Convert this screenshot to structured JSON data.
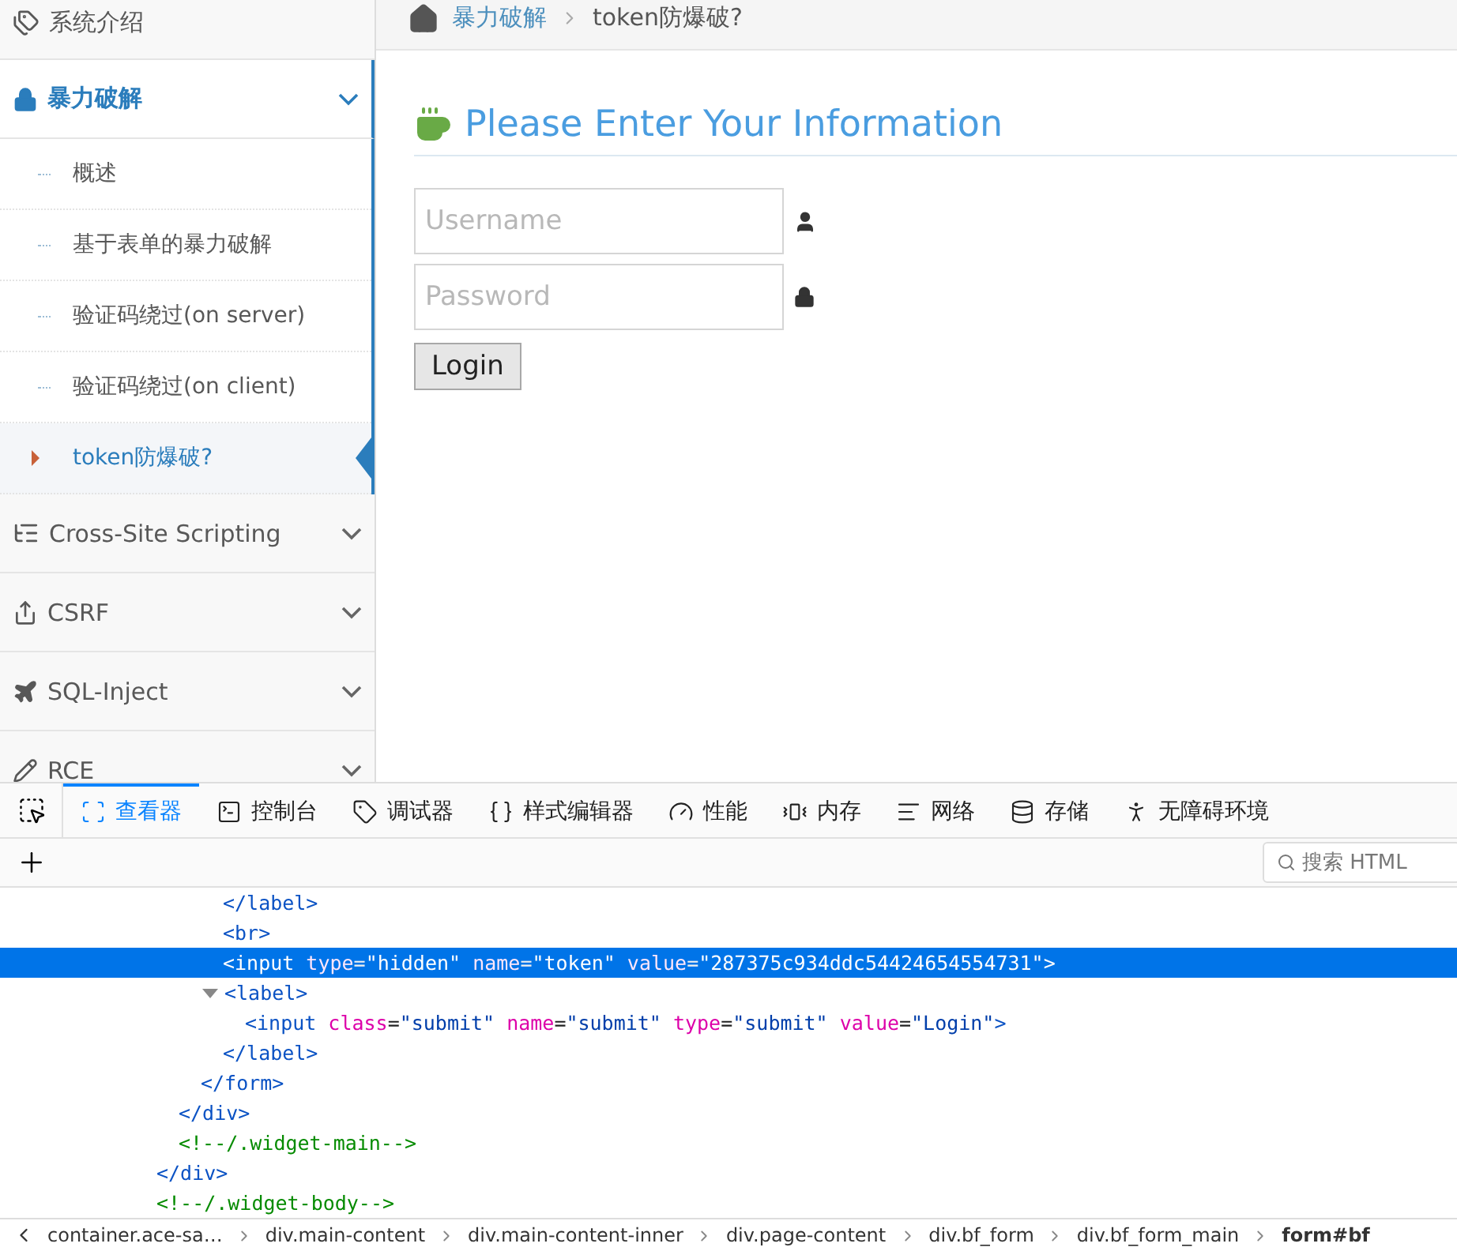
{
  "sidebar": {
    "items": [
      {
        "kind": "link",
        "label": "系统介绍"
      },
      {
        "kind": "section",
        "label": "暴力破解",
        "expanded": true,
        "children": [
          {
            "label": "概述",
            "selected": false
          },
          {
            "label": "基于表单的暴力破解",
            "selected": false
          },
          {
            "label": "验证码绕过(on server)",
            "selected": false
          },
          {
            "label": "验证码绕过(on client)",
            "selected": false
          },
          {
            "label": "token防爆破?",
            "selected": true
          }
        ]
      },
      {
        "kind": "section",
        "label": "Cross-Site Scripting",
        "expanded": false
      },
      {
        "kind": "section",
        "label": "CSRF",
        "expanded": false
      },
      {
        "kind": "section",
        "label": "SQL-Inject",
        "expanded": false
      },
      {
        "kind": "section",
        "label": "RCE",
        "expanded": false
      }
    ]
  },
  "breadcrumb": {
    "items": [
      {
        "label": "暴力破解",
        "link": true
      },
      {
        "label": "token防爆破?",
        "link": false
      }
    ]
  },
  "form": {
    "title": "Please Enter Your Information",
    "fields": [
      {
        "kind": "user",
        "placeholder": "Username"
      },
      {
        "kind": "password",
        "placeholder": "Password"
      }
    ],
    "button": "Login"
  },
  "devtools": {
    "tabs": [
      {
        "kind": "inspector",
        "label": "查看器",
        "selected": true
      },
      {
        "kind": "console",
        "label": "控制台",
        "selected": false
      },
      {
        "kind": "debugger",
        "label": "调试器",
        "selected": false
      },
      {
        "kind": "style",
        "label": "样式编辑器",
        "selected": false
      },
      {
        "kind": "performance",
        "label": "性能",
        "selected": false
      },
      {
        "kind": "memory",
        "label": "内存",
        "selected": false
      },
      {
        "kind": "network",
        "label": "网络",
        "selected": false
      },
      {
        "kind": "storage",
        "label": "存储",
        "selected": false
      },
      {
        "kind": "accessibility",
        "label": "无障碍环境",
        "selected": false
      }
    ],
    "search": {
      "placeholder": "搜索 HTML"
    },
    "code": [
      {
        "children": [
          {
            "children": [
              {
                "children": [
                  {
                    "selected": false,
                    "tokens": [
                      {
                        "kind": "tag",
                        "text": "</label>"
                      }
                    ]
                  },
                  {
                    "selected": false,
                    "tokens": [
                      {
                        "kind": "tag",
                        "text": "<br>"
                      }
                    ]
                  },
                  {
                    "selected": true,
                    "tokens": [
                      {
                        "kind": "tag",
                        "text": "<input"
                      },
                      {
                        "kind": "attr",
                        "text": " type"
                      },
                      {
                        "kind": "punct",
                        "text": "="
                      },
                      {
                        "kind": "value",
                        "text": "\"hidden\""
                      },
                      {
                        "kind": "attr",
                        "text": " name"
                      },
                      {
                        "kind": "punct",
                        "text": "="
                      },
                      {
                        "kind": "value",
                        "text": "\"token\""
                      },
                      {
                        "kind": "attr",
                        "text": " value"
                      },
                      {
                        "kind": "punct",
                        "text": "="
                      },
                      {
                        "kind": "value",
                        "text": "\"287375c934ddc54424654554731\""
                      },
                      {
                        "kind": "tag",
                        "text": ">"
                      }
                    ]
                  },
                  {
                    "selected": false,
                    "expanded": true,
                    "tokens": [
                      {
                        "kind": "tag",
                        "text": "<label>"
                      }
                    ],
                    "children": [
                      {
                        "selected": false,
                        "tokens": [
                          {
                            "kind": "tag",
                            "text": "<input"
                          },
                          {
                            "kind": "attr",
                            "text": " class"
                          },
                          {
                            "kind": "punct",
                            "text": "="
                          },
                          {
                            "kind": "value",
                            "text": "\"submit\""
                          },
                          {
                            "kind": "attr",
                            "text": " name"
                          },
                          {
                            "kind": "punct",
                            "text": "="
                          },
                          {
                            "kind": "value",
                            "text": "\"submit\""
                          },
                          {
                            "kind": "attr",
                            "text": " type"
                          },
                          {
                            "kind": "punct",
                            "text": "="
                          },
                          {
                            "kind": "value",
                            "text": "\"submit\""
                          },
                          {
                            "kind": "attr",
                            "text": " value"
                          },
                          {
                            "kind": "punct",
                            "text": "="
                          },
                          {
                            "kind": "value",
                            "text": "\"Login\""
                          },
                          {
                            "kind": "tag",
                            "text": ">"
                          }
                        ]
                      }
                    ]
                  },
                  {
                    "selected": false,
                    "tokens": [
                      {
                        "kind": "tag",
                        "text": "</label>"
                      }
                    ]
                  }
                ]
              },
              {
                "selected": false,
                "tokens": [
                  {
                    "kind": "tag",
                    "text": "</form>"
                  }
                ]
              }
            ]
          },
          {
            "selected": false,
            "tokens": [
              {
                "kind": "tag",
                "text": "</div>"
              }
            ]
          },
          {
            "selected": false,
            "tokens": [
              {
                "kind": "comment",
                "text": "<!--/.widget-main-->"
              }
            ]
          }
        ]
      },
      {
        "selected": false,
        "tokens": [
          {
            "kind": "tag",
            "text": "</div>"
          }
        ]
      },
      {
        "selected": false,
        "tokens": [
          {
            "kind": "comment",
            "text": "<!--/.widget-body-->"
          }
        ]
      }
    ],
    "path": [
      {
        "label": "container.ace-sa…",
        "selected": false
      },
      {
        "label": "div.main-content",
        "selected": false
      },
      {
        "label": "div.main-content-inner",
        "selected": false
      },
      {
        "label": "div.page-content",
        "selected": false
      },
      {
        "label": "div.bf_form",
        "selected": false
      },
      {
        "label": "div.bf_form_main",
        "selected": false
      },
      {
        "label": "form#bf",
        "selected": true
      }
    ]
  }
}
